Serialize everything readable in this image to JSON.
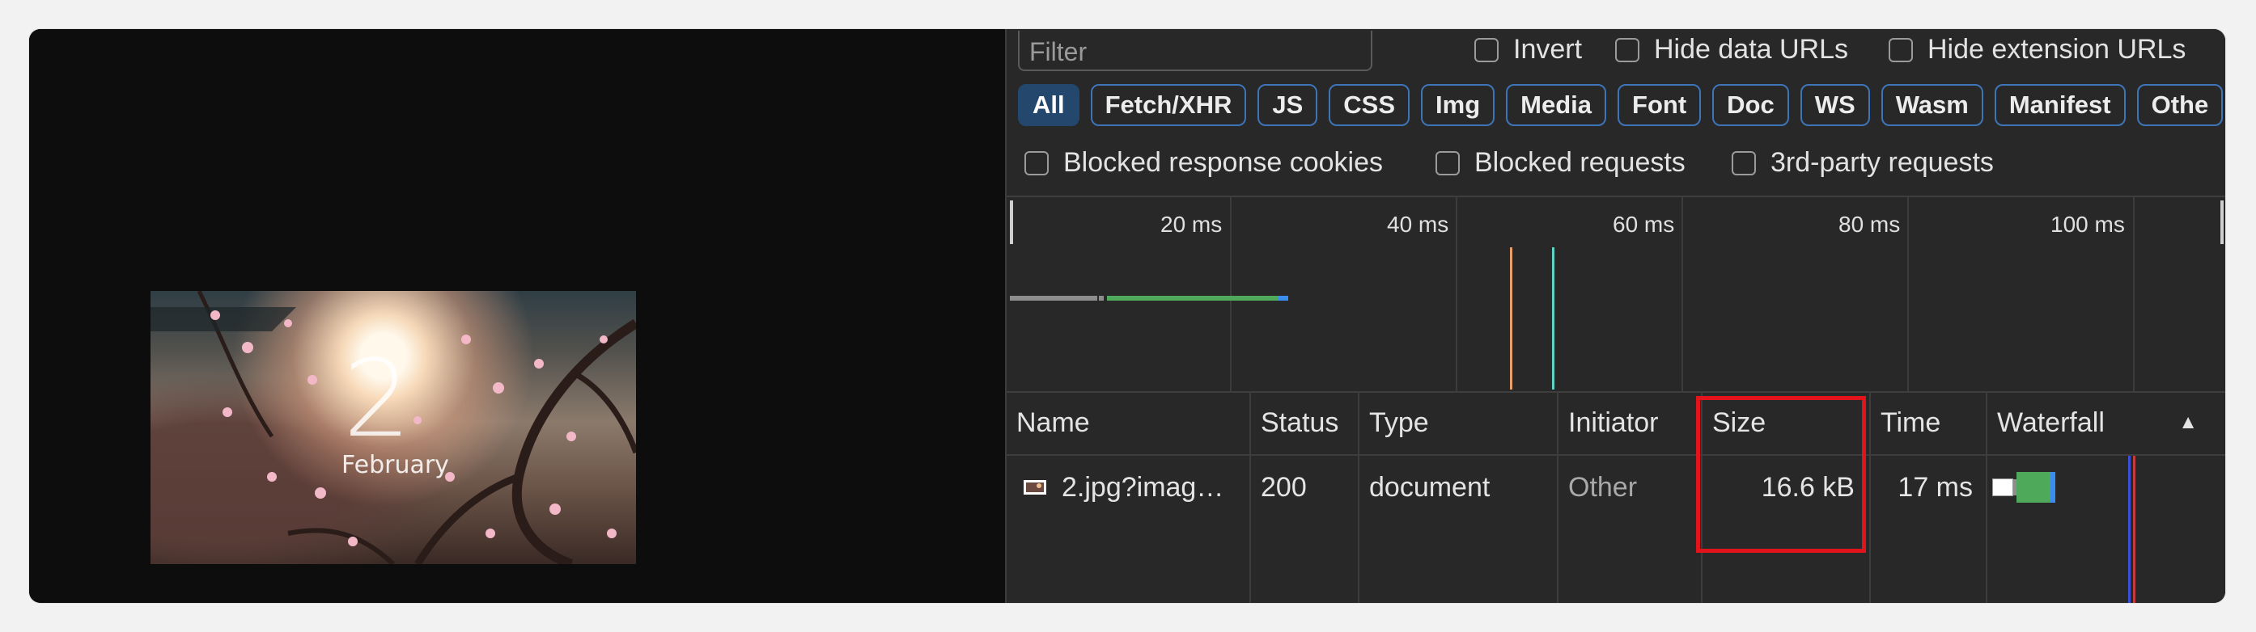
{
  "page_preview": {
    "day": "2",
    "month": "February"
  },
  "filter": {
    "placeholder": "Filter",
    "invert_label": "Invert",
    "hide_data_urls_label": "Hide data URLs",
    "hide_extension_urls_label": "Hide extension URLs"
  },
  "type_filters": [
    "All",
    "Fetch/XHR",
    "JS",
    "CSS",
    "Img",
    "Media",
    "Font",
    "Doc",
    "WS",
    "Wasm",
    "Manifest",
    "Othe"
  ],
  "active_type_filter": "All",
  "extra_filters": {
    "blocked_cookies_label": "Blocked response cookies",
    "blocked_requests_label": "Blocked requests",
    "third_party_label": "3rd-party requests"
  },
  "timeline": {
    "ticks": [
      "20 ms",
      "40 ms",
      "60 ms",
      "80 ms",
      "100 ms"
    ]
  },
  "table": {
    "columns": {
      "name": "Name",
      "status": "Status",
      "type": "Type",
      "initiator": "Initiator",
      "size": "Size",
      "time": "Time",
      "waterfall": "Waterfall"
    },
    "sort_indicator": "▲",
    "rows": [
      {
        "name": "2.jpg?imag…",
        "status": "200",
        "type": "document",
        "initiator": "Other",
        "size": "16.6 kB",
        "time": "17 ms"
      }
    ]
  },
  "colors": {
    "accent": "#3e74b8",
    "active_pill": "#24476e",
    "highlight_box": "#e3131b",
    "waterfall_green": "#4ea95a",
    "waterfall_blue": "#3b8cef"
  }
}
